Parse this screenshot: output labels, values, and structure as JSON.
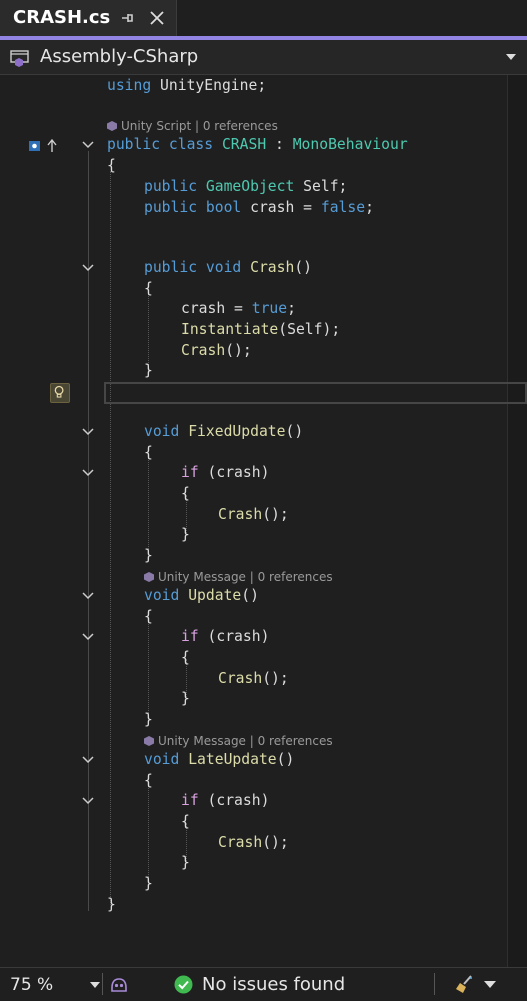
{
  "tab": {
    "title": "CRASH.cs",
    "pin_icon": "pin-icon",
    "close_icon": "close-icon"
  },
  "project": {
    "name": "Assembly-CSharp",
    "icon": "project-icon"
  },
  "lenses": {
    "class_lens": "Unity Script | 0 references",
    "fixedupdate_lens": "Unity Message | 0 references",
    "update_lens": "Unity Message | 0 references",
    "lateupdate_lens": "Unity Message | 0 references"
  },
  "code": {
    "l1_kw": "using",
    "l1_rest": " UnityEngine;",
    "l2_kw1": "public",
    "l2_kw2": "class",
    "l2_name": "CRASH",
    "l2_colon": " : ",
    "l2_base": "MonoBehaviour",
    "open_brace": "{",
    "close_brace": "}",
    "l4_kw": "public",
    "l4_type": "GameObject",
    "l4_rest": " Self;",
    "l5_kw1": "public",
    "l5_kw2": "bool",
    "l5_mid": " crash = ",
    "l5_val": "false",
    "l5_end": ";",
    "m1_kw1": "public",
    "m1_kw2": "void",
    "m1_name": "Crash",
    "m1_paren": "()",
    "b1_a": "crash = ",
    "b1_val": "true",
    "b1_end": ";",
    "b2_fn": "Instantiate",
    "b2_rest": "(Self);",
    "b3_fn": "Crash",
    "b3_rest": "();",
    "void_kw": "void",
    "fixed_name": "FixedUpdate",
    "update_name": "Update",
    "late_name": "LateUpdate",
    "parens": "()",
    "if_kw": "if",
    "if_rest": " (crash)",
    "call_fn": "Crash",
    "call_rest": "();"
  },
  "status": {
    "zoom": "75 %",
    "issues": "No issues found",
    "issues_icon": "check-circle-icon",
    "copilot_icon": "copilot-icon",
    "cleanup_icon": "broom-icon"
  },
  "colors": {
    "accent": "#9184e2",
    "keyword": "#569cd6",
    "control": "#d8a0df",
    "type": "#4ec9b0",
    "method": "#dcdcaa",
    "ok": "#3fb950"
  }
}
